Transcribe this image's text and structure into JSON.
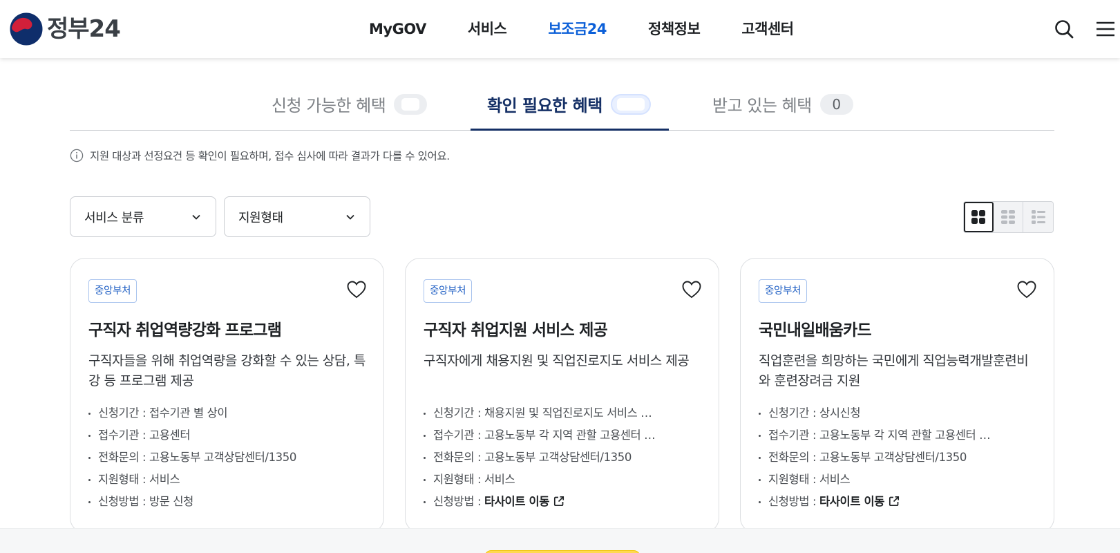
{
  "header": {
    "logo_text": "정부24",
    "nav": [
      {
        "label": "MyGOV",
        "active": false
      },
      {
        "label": "서비스",
        "active": false
      },
      {
        "label": "보조금24",
        "active": true
      },
      {
        "label": "정책정보",
        "active": false
      },
      {
        "label": "고객센터",
        "active": false
      }
    ],
    "search_icon": "search-icon",
    "menu_icon": "hamburger-menu-icon"
  },
  "tabs": [
    {
      "label": "신청 가능한 혜택",
      "count": "",
      "active": false
    },
    {
      "label": "확인 필요한 혜택",
      "count": "",
      "active": true
    },
    {
      "label": "받고 있는 혜택",
      "count": "0",
      "active": false
    }
  ],
  "notice": "지원 대상과 선정요건 등 확인이 필요하며, 접수 심사에 따라 결과가 다를 수 있어요.",
  "filters": [
    {
      "label": "서비스 분류"
    },
    {
      "label": "지원형태"
    }
  ],
  "view_modes": [
    "card-grid-icon",
    "compact-grid-icon",
    "list-icon"
  ],
  "cards": [
    {
      "badge": "중앙부처",
      "title": "구직자 취업역량강화 프로그램",
      "desc": "구직자들을 위해 취업역량을 강화할 수 있는 상담, 특강 등 프로그램 제공",
      "info": [
        {
          "key": "신청기간 : ",
          "value": "접수기관 별 상이"
        },
        {
          "key": "접수기관 : ",
          "value": "고용센터"
        },
        {
          "key": "전화문의 : ",
          "value": "고용노동부 고객상담센터/1350"
        },
        {
          "key": "지원형태 : ",
          "value": "서비스"
        },
        {
          "key": "신청방법 : ",
          "value": "방문 신청"
        }
      ]
    },
    {
      "badge": "중앙부처",
      "title": "구직자 취업지원 서비스 제공",
      "desc": "구직자에게 채용지원 및 직업진로지도 서비스 제공",
      "info": [
        {
          "key": "신청기간 : ",
          "value": "채용지원 및 직업진로지도 서비스 …"
        },
        {
          "key": "접수기관 : ",
          "value": "고용노동부 각 지역 관할 고용센터 …"
        },
        {
          "key": "전화문의 : ",
          "value": "고용노동부 고객상담센터/1350"
        },
        {
          "key": "지원형태 : ",
          "value": "서비스"
        },
        {
          "key": "신청방법 : ",
          "value": "타사이트 이동"
        }
      ]
    },
    {
      "badge": "중앙부처",
      "title": "국민내일배움카드",
      "desc": "직업훈련을 희망하는 국민에게 직업능력개발훈련비와 훈련장려금 지원",
      "info": [
        {
          "key": "신청기간 : ",
          "value": "상시신청"
        },
        {
          "key": "접수기관 : ",
          "value": "고용노동부 각 지역 관할 고용센터 …"
        },
        {
          "key": "전화문의 : ",
          "value": "고용노동부 고객상담센터/1350"
        },
        {
          "key": "지원형태 : ",
          "value": "서비스"
        },
        {
          "key": "신청방법 : ",
          "value": "타사이트 이동"
        }
      ]
    }
  ],
  "colors": {
    "accent": "#0b5fd8",
    "tab_active": "#142f65",
    "badge": "#1f5fc4"
  }
}
